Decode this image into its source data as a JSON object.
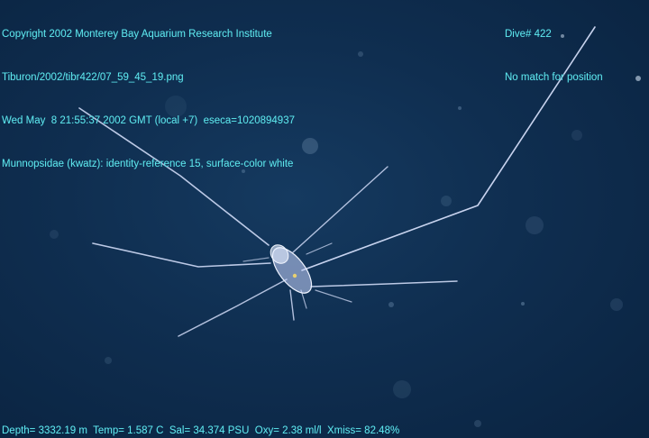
{
  "overlay": {
    "copyright": "Copyright 2002 Monterey Bay Aquarium Research Institute",
    "file": "Tiburon/2002/tibr422/07_59_45_19.png",
    "datetime": "Wed May  8 21:55:37 2002 GMT (local +7)  eseca=1020894937",
    "annotation": "Munnopsidae (kwatz): identity-reference 15, surface-color white",
    "dive": "Dive# 422",
    "position": "No match for position",
    "sensors": "Depth= 3332.19 m  Temp= 1.587 C  Sal= 34.374 PSU  Oxy= 2.38 ml/l  Xmiss= 82.48%"
  },
  "colors": {
    "overlay_text": "#5ee8ee",
    "water": "#0f2e50",
    "animal": "#dbe4ff"
  }
}
